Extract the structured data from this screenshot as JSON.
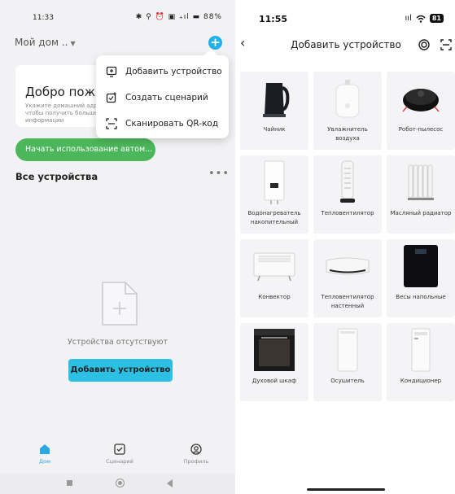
{
  "left_phone": {
    "status_bar": {
      "time": "11:33",
      "icons": "✱ ⚲ ⏰ ▣ ₊ıl ▬ 88%"
    },
    "header": {
      "home_name": "Мой дом ..",
      "add_icon": "plus-icon"
    },
    "welcome": {
      "title": "Добро пожаловать",
      "hint": "Укажите домашний адрес, чтобы получить больше информации"
    },
    "start_button": "Начать использование автом...",
    "devices": {
      "title": "Все устройства",
      "more_icon": "more-dots-icon"
    },
    "empty": {
      "text": "Устройства отсутствуют",
      "button": "Добавить устройство"
    },
    "menu": [
      {
        "label": "Добавить устройство",
        "icon": "add-device-icon"
      },
      {
        "label": "Создать сценарий",
        "icon": "create-scene-icon"
      },
      {
        "label": "Сканировать QR-код",
        "icon": "scan-qr-icon"
      }
    ],
    "bottom_nav": [
      {
        "label": "Дом",
        "icon": "home-icon",
        "active": true
      },
      {
        "label": "Сценарий",
        "icon": "scene-icon",
        "active": false
      },
      {
        "label": "Профиль",
        "icon": "profile-icon",
        "active": false
      }
    ],
    "accent_color": "#1fb1e8",
    "start_color": "#4cb75a"
  },
  "right_phone": {
    "status_bar": {
      "time": "11:55",
      "signal": "ııl",
      "wifi": "wifi-icon",
      "battery": "81"
    },
    "header": {
      "title": "Добавить устройство",
      "back_icon": "back-arrow-icon",
      "target_icon": "target-icon",
      "scan_icon": "scan-icon"
    },
    "devices": [
      {
        "label": "Чайник",
        "icon": "kettle-icon"
      },
      {
        "label": "Увлажнитель воздуха",
        "icon": "humidifier-icon"
      },
      {
        "label": "Робот-пылесос",
        "icon": "robot-vacuum-icon"
      },
      {
        "label": "Водонагреватель накопительный",
        "icon": "water-heater-icon"
      },
      {
        "label": "Тепловентилятор",
        "icon": "fan-heater-icon"
      },
      {
        "label": "Масляный радиатор",
        "icon": "oil-radiator-icon"
      },
      {
        "label": "Конвектор",
        "icon": "convector-icon"
      },
      {
        "label": "Тепловентилятор настенный",
        "icon": "wall-heater-icon"
      },
      {
        "label": "Весы напольные",
        "icon": "floor-scale-icon"
      },
      {
        "label": "Духовой шкаф",
        "icon": "oven-icon"
      },
      {
        "label": "Осушитель",
        "icon": "dehumidifier-icon"
      },
      {
        "label": "Кондиционер",
        "icon": "air-conditioner-icon"
      }
    ]
  }
}
